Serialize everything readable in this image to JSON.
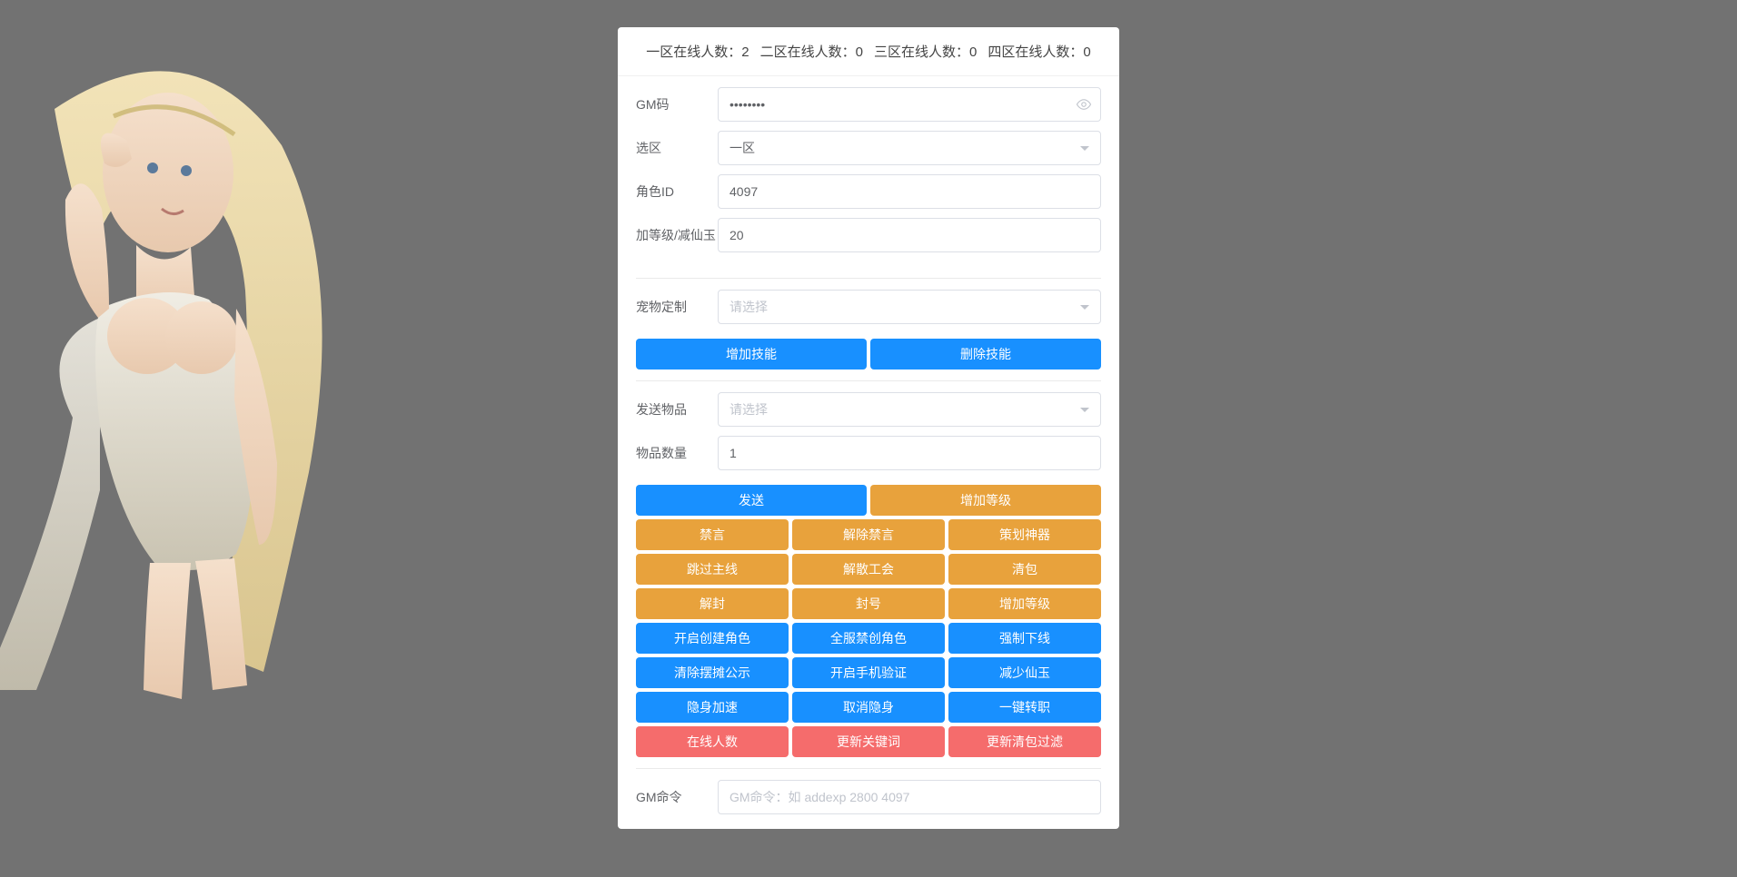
{
  "stats": {
    "zone1_label": "一区在线人数：",
    "zone1_value": "2",
    "zone2_label": "二区在线人数：",
    "zone2_value": "0",
    "zone3_label": "三区在线人数：",
    "zone3_value": "0",
    "zone4_label": "四区在线人数：",
    "zone4_value": "0"
  },
  "form": {
    "gm_code_label": "GM码",
    "gm_code_value": "••••••••",
    "zone_label": "选区",
    "zone_value": "一区",
    "role_id_label": "角色ID",
    "role_id_value": "4097",
    "level_label": "加等级/减仙玉",
    "level_value": "20",
    "pet_label": "宠物定制",
    "pet_placeholder": "请选择",
    "item_send_label": "发送物品",
    "item_send_placeholder": "请选择",
    "item_qty_label": "物品数量",
    "item_qty_value": "1",
    "gm_cmd_label": "GM命令",
    "gm_cmd_placeholder": "GM命令：如 addexp 2800 4097"
  },
  "buttons": {
    "add_skill": "增加技能",
    "del_skill": "删除技能",
    "send": "发送",
    "add_level": "增加等级",
    "mute": "禁言",
    "unmute": "解除禁言",
    "planner_artifact": "策划神器",
    "skip_main": "跳过主线",
    "disband_guild": "解散工会",
    "clear_bag": "清包",
    "unban": "解封",
    "ban": "封号",
    "add_level2": "增加等级",
    "open_create_role": "开启创建角色",
    "global_ban_create": "全服禁创角色",
    "force_offline": "强制下线",
    "clear_marquee": "清除摆摊公示",
    "open_phone_verify": "开启手机验证",
    "reduce_xianyu": "减少仙玉",
    "stealth_speedup": "隐身加速",
    "cancel_stealth": "取消隐身",
    "one_key_transfer": "一键转职",
    "online_count": "在线人数",
    "update_keywords": "更新关键词",
    "update_clear_filter": "更新清包过滤"
  }
}
